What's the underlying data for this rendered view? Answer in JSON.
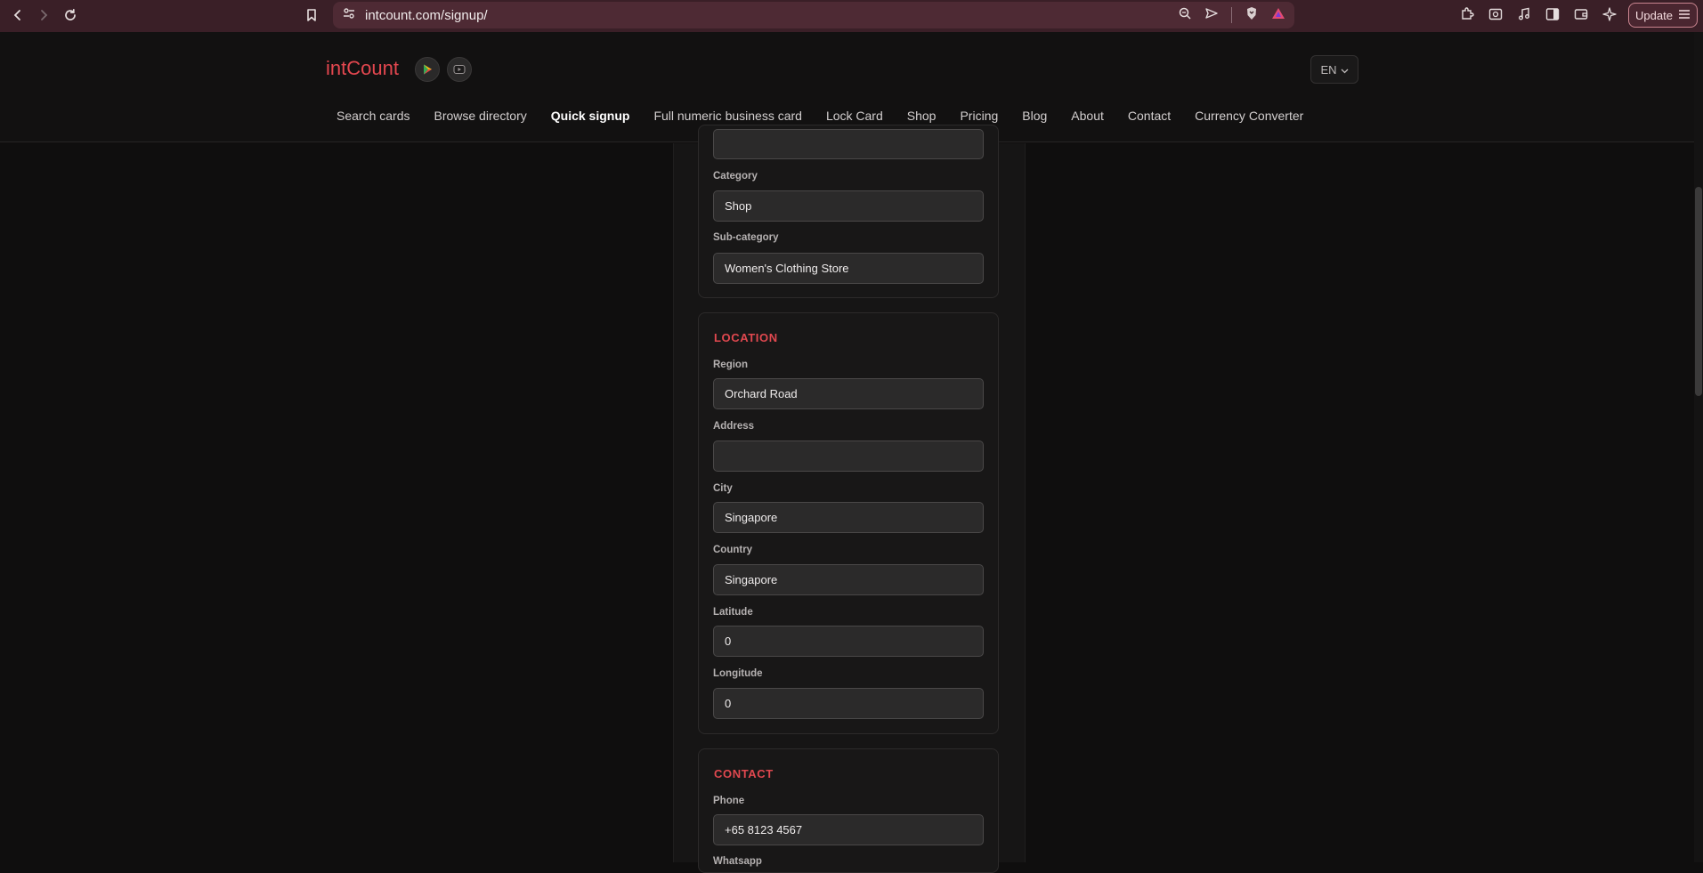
{
  "browser": {
    "url": "intcount.com/signup/",
    "update_label": "Update"
  },
  "site": {
    "logo": "intCount",
    "lang": "EN",
    "nav": [
      {
        "label": "Search cards"
      },
      {
        "label": "Browse directory"
      },
      {
        "label": "Quick signup",
        "active": true
      },
      {
        "label": "Full numeric business card"
      },
      {
        "label": "Lock Card"
      },
      {
        "label": "Shop"
      },
      {
        "label": "Pricing"
      },
      {
        "label": "Blog"
      },
      {
        "label": "About"
      },
      {
        "label": "Contact"
      },
      {
        "label": "Currency Converter"
      }
    ]
  },
  "form": {
    "business": {
      "category_label": "Category",
      "category_value": "Shop",
      "subcategory_label": "Sub-category",
      "subcategory_value": "Women's Clothing Store"
    },
    "location": {
      "title": "LOCATION",
      "region_label": "Region",
      "region_value": "Orchard Road",
      "address_label": "Address",
      "address_value": "",
      "city_label": "City",
      "city_value": "Singapore",
      "country_label": "Country",
      "country_value": "Singapore",
      "latitude_label": "Latitude",
      "latitude_value": "0",
      "longitude_label": "Longitude",
      "longitude_value": "0"
    },
    "contact": {
      "title": "CONTACT",
      "phone_label": "Phone",
      "phone_value": "+65 8123 4567",
      "whatsapp_label": "Whatsapp"
    }
  },
  "colors": {
    "accent": "#e3474f",
    "chrome": "#3a1f27",
    "background": "#0f0e0e"
  }
}
